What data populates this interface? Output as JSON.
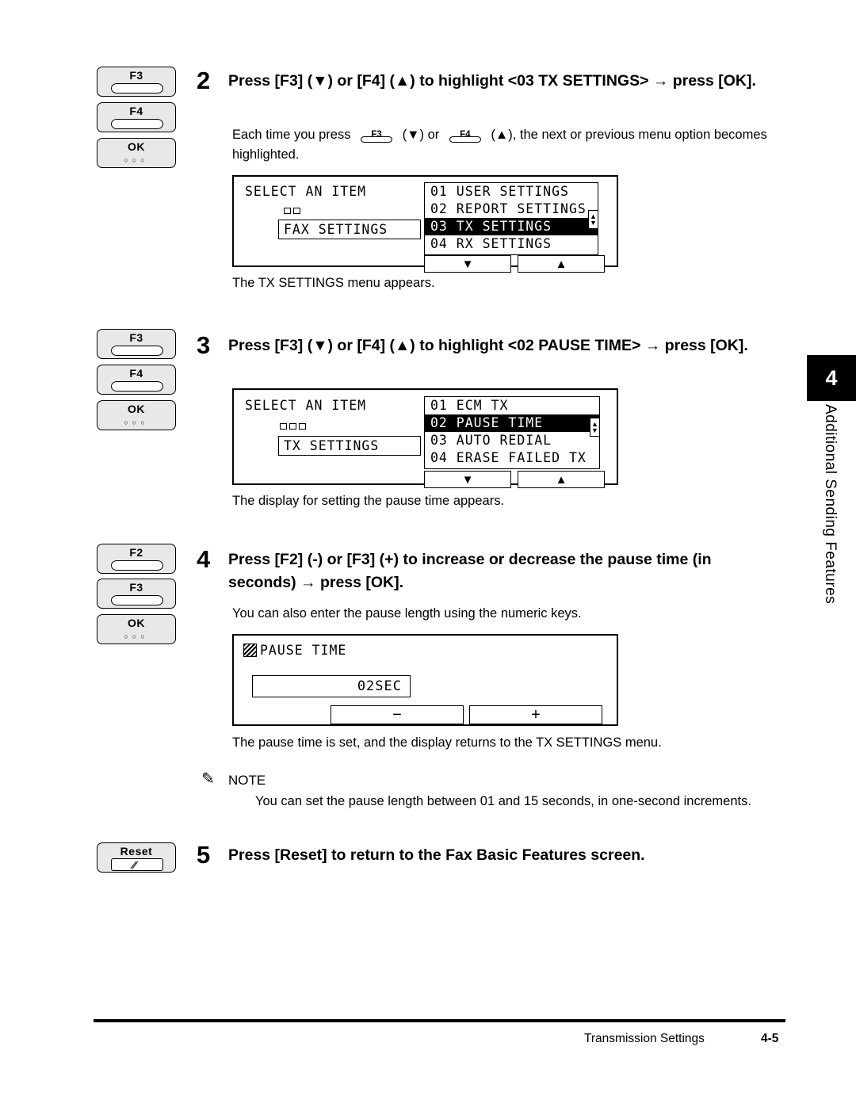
{
  "steps": [
    {
      "number": "2",
      "title": "Press [F3] (▼) or [F4] (▲) to highlight <03 TX SETTINGS> → press [OK].",
      "keys": [
        "F3",
        "F4",
        "OK"
      ],
      "intro_before": "Each time you press",
      "intro_mid": "(▼) or",
      "intro_after": "(▲), the next or previous menu option becomes highlighted.",
      "caption": "The TX SETTINGS menu appears.",
      "screen": {
        "title": "SELECT AN ITEM",
        "context": "FAX SETTINGS",
        "items": [
          "01 USER SETTINGS",
          "02 REPORT SETTINGS",
          "03 TX SETTINGS",
          "04 RX SETTINGS"
        ],
        "selected_index": 2,
        "softkeys": [
          "▼",
          "▲"
        ]
      }
    },
    {
      "number": "3",
      "title": "Press [F3] (▼) or [F4] (▲) to highlight <02 PAUSE TIME> → press [OK].",
      "keys": [
        "F3",
        "F4",
        "OK"
      ],
      "caption": "The display for setting the pause time appears.",
      "screen": {
        "title": "SELECT AN ITEM",
        "context": "TX SETTINGS",
        "items": [
          "01 ECM TX",
          "02 PAUSE TIME",
          "03 AUTO REDIAL",
          "04 ERASE FAILED TX"
        ],
        "selected_index": 1,
        "softkeys": [
          "▼",
          "▲"
        ]
      }
    },
    {
      "number": "4",
      "title": "Press [F2] (-) or [F3] (+) to increase or decrease the pause time (in seconds) → press [OK].",
      "keys": [
        "F2",
        "F3",
        "OK"
      ],
      "body": "You can also enter the pause length using the numeric keys.",
      "caption": "The pause time is set, and the display returns to the TX SETTINGS menu.",
      "screen": {
        "title": "PAUSE TIME",
        "value": "02SEC",
        "softkeys": [
          "−",
          "+"
        ]
      }
    },
    {
      "number": "5",
      "title": "Press [Reset] to return to the Fax Basic Features screen.",
      "keys": [
        "Reset"
      ]
    }
  ],
  "note": {
    "label": "NOTE",
    "text": "You can set the pause length between 01 and 15 seconds, in one-second increments."
  },
  "side_tab": {
    "number": "4",
    "label": "Additional Sending Features"
  },
  "footer": {
    "chapter": "Transmission Settings",
    "page": "4-5"
  }
}
